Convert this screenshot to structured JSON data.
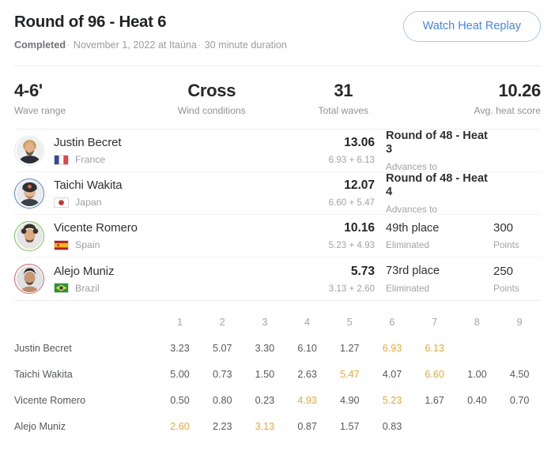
{
  "header": {
    "title": "Round of 96 - Heat 6",
    "status": "Completed",
    "date": "November 1, 2022 at Itaúna",
    "duration": "30 minute duration",
    "separator": "·",
    "replay_button": "Watch Heat Replay",
    "accent_blue": "#4285f4"
  },
  "stats": [
    {
      "value": "4-6'",
      "label": "Wave range"
    },
    {
      "value": "Cross",
      "label": "Wind conditions"
    },
    {
      "value": "31",
      "label": "Total waves"
    },
    {
      "value": "10.26",
      "label": "Avg. heat score"
    }
  ],
  "athletes": [
    {
      "name": "Justin Becret",
      "country": "France",
      "flag": "france-flag",
      "ring_color": "#e2e4e6",
      "total": "13.06",
      "parts": "6.93 + 6.13",
      "outcome": "Round of 48 - Heat 3",
      "outcome_bold": true,
      "outcome_sub": "Advances to",
      "points": "",
      "points_label": ""
    },
    {
      "name": "Taichi Wakita",
      "country": "Japan",
      "flag": "japan-flag",
      "ring_color": "#4d7fd6",
      "total": "12.07",
      "parts": "6.60 + 5.47",
      "outcome": "Round of 48 - Heat 4",
      "outcome_bold": true,
      "outcome_sub": "Advances to",
      "points": "",
      "points_label": ""
    },
    {
      "name": "Vicente Romero",
      "country": "Spain",
      "flag": "spain-flag",
      "ring_color": "#76c24a",
      "total": "10.16",
      "parts": "5.23 + 4.93",
      "outcome": "49th place",
      "outcome_bold": false,
      "outcome_sub": "Eliminated",
      "points": "300",
      "points_label": "Points"
    },
    {
      "name": "Alejo Muniz",
      "country": "Brazil",
      "flag": "brazil-flag",
      "ring_color": "#e05a5a",
      "total": "5.73",
      "parts": "3.13 + 2.60",
      "outcome": "73rd place",
      "outcome_bold": false,
      "outcome_sub": "Eliminated",
      "points": "250",
      "points_label": "Points"
    }
  ],
  "wave_table": {
    "columns": [
      "1",
      "2",
      "3",
      "4",
      "5",
      "6",
      "7",
      "8",
      "9"
    ],
    "highlight_color": "#f0a830",
    "rows": [
      {
        "athlete": "Justin Becret",
        "scores": [
          "3.23",
          "5.07",
          "3.30",
          "6.10",
          "1.27",
          "6.93",
          "6.13",
          "",
          ""
        ],
        "counted": [
          false,
          false,
          false,
          false,
          false,
          true,
          true,
          false,
          false
        ]
      },
      {
        "athlete": "Taichi Wakita",
        "scores": [
          "5.00",
          "0.73",
          "1.50",
          "2.63",
          "5.47",
          "4.07",
          "6.60",
          "1.00",
          "4.50"
        ],
        "counted": [
          false,
          false,
          false,
          false,
          true,
          false,
          true,
          false,
          false
        ]
      },
      {
        "athlete": "Vicente Romero",
        "scores": [
          "0.50",
          "0.80",
          "0.23",
          "4.93",
          "4.90",
          "5.23",
          "1.67",
          "0.40",
          "0.70"
        ],
        "counted": [
          false,
          false,
          false,
          true,
          false,
          true,
          false,
          false,
          false
        ]
      },
      {
        "athlete": "Alejo Muniz",
        "scores": [
          "2.60",
          "2.23",
          "3.13",
          "0.87",
          "1.57",
          "0.83",
          "",
          "",
          ""
        ],
        "counted": [
          true,
          false,
          true,
          false,
          false,
          false,
          false,
          false,
          false
        ]
      }
    ]
  }
}
